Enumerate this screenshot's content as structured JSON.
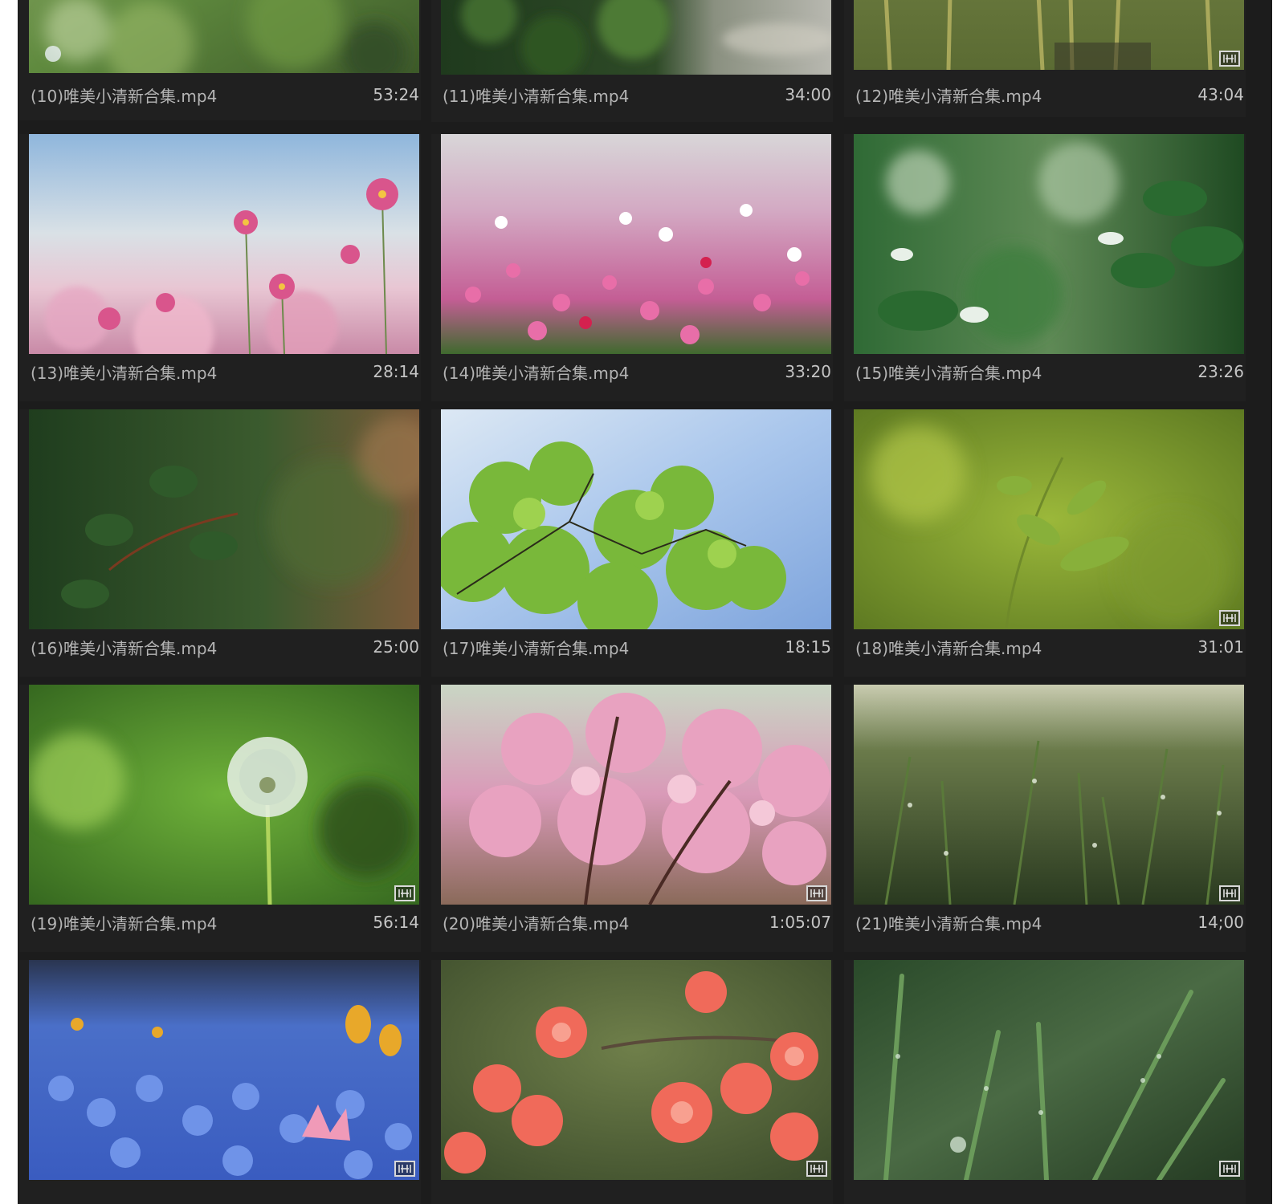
{
  "icons": {
    "clip_badge": "audio-video-clip-icon"
  },
  "tiles": [
    {
      "name": "(10)唯美小清新合集.mp4",
      "duration": "53:24",
      "scene": "green-bokeh",
      "badge": false
    },
    {
      "name": "(11)唯美小清新合集.mp4",
      "duration": "34:00",
      "scene": "shrub-path",
      "badge": false
    },
    {
      "name": "(12)唯美小清新合集.mp4",
      "duration": "43:04",
      "scene": "reeds",
      "badge": true
    },
    {
      "name": "(13)唯美小清新合集.mp4",
      "duration": "28:14",
      "scene": "cosmos-sky",
      "badge": false
    },
    {
      "name": "(14)唯美小清新合集.mp4",
      "duration": "33:20",
      "scene": "cosmos-field",
      "badge": false
    },
    {
      "name": "(15)唯美小清新合集.mp4",
      "duration": "23:26",
      "scene": "green-leaves",
      "badge": false
    },
    {
      "name": "(16)唯美小清新合集.mp4",
      "duration": "25:00",
      "scene": "dark-leaves",
      "badge": false
    },
    {
      "name": "(17)唯美小清新合集.mp4",
      "duration": "18:15",
      "scene": "tree-sky",
      "badge": false
    },
    {
      "name": "(18)唯美小清新合集.mp4",
      "duration": "31:01",
      "scene": "sprout",
      "badge": true
    },
    {
      "name": "(19)唯美小清新合集.mp4",
      "duration": "56:14",
      "scene": "dandelion",
      "badge": true
    },
    {
      "name": "(20)唯美小清新合集.mp4",
      "duration": "1:05:07",
      "scene": "blossom",
      "badge": true
    },
    {
      "name": "(21)唯美小清新合集.mp4",
      "duration": "14;00",
      "scene": "dewy-grass",
      "badge": true
    },
    {
      "name": "",
      "duration": "",
      "scene": "blue-flowers",
      "badge": true
    },
    {
      "name": "",
      "duration": "",
      "scene": "azalea",
      "badge": true
    },
    {
      "name": "",
      "duration": "",
      "scene": "wet-grass",
      "badge": true
    }
  ]
}
